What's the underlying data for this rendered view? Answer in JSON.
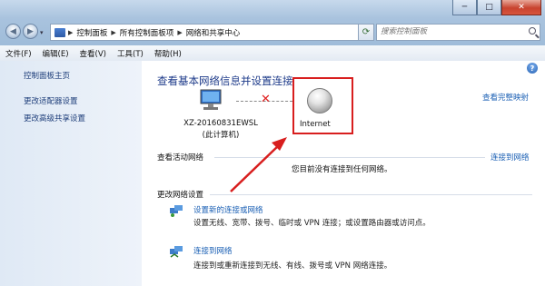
{
  "window": {
    "minimize_label": "─",
    "maximize_label": "□",
    "close_label": "✕"
  },
  "address": {
    "crumbs": [
      "控制面板",
      "所有控制面板项",
      "网络和共享中心"
    ],
    "search_placeholder": "搜索控制面板"
  },
  "menu": [
    "文件(F)",
    "编辑(E)",
    "查看(V)",
    "工具(T)",
    "帮助(H)"
  ],
  "sidebar": {
    "items": [
      {
        "label": "控制面板主页"
      },
      {
        "label": "更改适配器设置"
      },
      {
        "label": "更改高级共享设置"
      }
    ]
  },
  "main": {
    "title": "查看基本网络信息并设置连接",
    "full_map_link": "查看完整映射",
    "computer": {
      "name": "XZ-20160831EWSL",
      "sub": "(此计算机)"
    },
    "internet_label": "Internet",
    "active_networks": {
      "heading": "查看活动网络",
      "connect_link": "连接到网络",
      "status": "您目前没有连接到任何网络。"
    },
    "change_settings": {
      "heading": "更改网络设置",
      "tasks": [
        {
          "link": "设置新的连接或网络",
          "desc": "设置无线、宽带、拨号、临时或 VPN 连接；或设置路由器或访问点。"
        },
        {
          "link": "连接到网络",
          "desc": "连接到或重新连接到无线、有线、拨号或 VPN 网络连接。"
        }
      ]
    }
  },
  "colors": {
    "link": "#1a5fb4",
    "title": "#1e3b8a",
    "annotation_red": "#d81e1e"
  }
}
